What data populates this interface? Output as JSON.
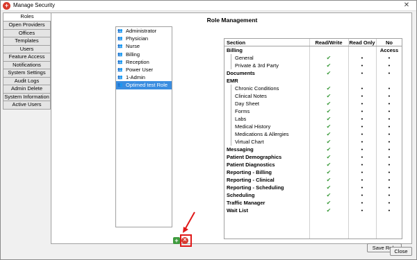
{
  "window": {
    "title": "Manage Security",
    "close_glyph": "✕"
  },
  "side_tabs": [
    "Roles",
    "Open Providers",
    "Offices",
    "Templates",
    "Users",
    "Feature Access",
    "Notifications",
    "System Settings",
    "Audit Logs",
    "Admin Delete",
    "System Information",
    "Active Users"
  ],
  "active_tab": "Roles",
  "panel_title": "Role Management",
  "roles": [
    {
      "label": "Administrator",
      "selected": false
    },
    {
      "label": "Physician",
      "selected": false
    },
    {
      "label": "Nurse",
      "selected": false
    },
    {
      "label": "Billing",
      "selected": false
    },
    {
      "label": "Reception",
      "selected": false
    },
    {
      "label": "Power User",
      "selected": false
    },
    {
      "label": "1-Admin",
      "selected": false
    },
    {
      "label": "Optimed test Role",
      "selected": true
    }
  ],
  "table": {
    "headers": {
      "section": "Section",
      "rw": "Read/Write",
      "ro": "Read Only",
      "na": "No Access"
    },
    "rows": [
      {
        "label": "Billing",
        "level": 0,
        "bold": true,
        "rw": "",
        "ro": "",
        "na": ""
      },
      {
        "label": "General",
        "level": 1,
        "bold": false,
        "rw": "✔",
        "ro": "•",
        "na": "•"
      },
      {
        "label": "Private & 3rd Party",
        "level": 1,
        "bold": false,
        "rw": "✔",
        "ro": "•",
        "na": "•"
      },
      {
        "label": "Documents",
        "level": 0,
        "bold": true,
        "rw": "✔",
        "ro": "•",
        "na": "•"
      },
      {
        "label": "EMR",
        "level": 0,
        "bold": true,
        "rw": "",
        "ro": "",
        "na": ""
      },
      {
        "label": "Chronic Conditions",
        "level": 1,
        "bold": false,
        "rw": "✔",
        "ro": "•",
        "na": "•"
      },
      {
        "label": "Clinical Notes",
        "level": 1,
        "bold": false,
        "rw": "✔",
        "ro": "•",
        "na": "•"
      },
      {
        "label": "Day Sheet",
        "level": 1,
        "bold": false,
        "rw": "✔",
        "ro": "•",
        "na": "•"
      },
      {
        "label": "Forms",
        "level": 1,
        "bold": false,
        "rw": "✔",
        "ro": "•",
        "na": "•"
      },
      {
        "label": "Labs",
        "level": 1,
        "bold": false,
        "rw": "✔",
        "ro": "•",
        "na": "•"
      },
      {
        "label": "Medical History",
        "level": 1,
        "bold": false,
        "rw": "✔",
        "ro": "•",
        "na": "•"
      },
      {
        "label": "Medications & Allergies",
        "level": 1,
        "bold": false,
        "rw": "✔",
        "ro": "•",
        "na": "•"
      },
      {
        "label": "Virtual Chart",
        "level": 1,
        "bold": false,
        "rw": "✔",
        "ro": "•",
        "na": "•"
      },
      {
        "label": "Messaging",
        "level": 0,
        "bold": true,
        "rw": "✔",
        "ro": "•",
        "na": "•"
      },
      {
        "label": "Patient Demographics",
        "level": 0,
        "bold": true,
        "rw": "✔",
        "ro": "•",
        "na": "•"
      },
      {
        "label": "Patient Diagnostics",
        "level": 0,
        "bold": true,
        "rw": "✔",
        "ro": "•",
        "na": "•"
      },
      {
        "label": "Reporting - Billing",
        "level": 0,
        "bold": true,
        "rw": "✔",
        "ro": "•",
        "na": "•"
      },
      {
        "label": "Reporting - Clinical",
        "level": 0,
        "bold": true,
        "rw": "✔",
        "ro": "•",
        "na": "•"
      },
      {
        "label": "Reporting - Scheduling",
        "level": 0,
        "bold": true,
        "rw": "✔",
        "ro": "•",
        "na": "•"
      },
      {
        "label": "Scheduling",
        "level": 0,
        "bold": true,
        "rw": "✔",
        "ro": "•",
        "na": "•"
      },
      {
        "label": "Traffic Manager",
        "level": 0,
        "bold": true,
        "rw": "✔",
        "ro": "•",
        "na": "•"
      },
      {
        "label": "Wait List",
        "level": 0,
        "bold": true,
        "rw": "✔",
        "ro": "•",
        "na": "•"
      }
    ]
  },
  "buttons": {
    "add": "+",
    "delete": "✕",
    "save_role": "Save Role",
    "close": "Close"
  },
  "colors": {
    "selection": "#3a8de0",
    "check": "#3a9a3a",
    "highlight": "#e01818"
  }
}
